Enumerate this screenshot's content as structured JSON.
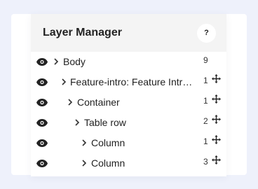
{
  "panel": {
    "title": "Layer Manager",
    "help_label": "?"
  },
  "layers": [
    {
      "name": "Body",
      "count": "9",
      "has_move": false,
      "level": 0
    },
    {
      "name": "Feature-intro: Feature Intro ...",
      "count": "1",
      "has_move": true,
      "level": 1
    },
    {
      "name": "Container",
      "count": "1",
      "has_move": true,
      "level": 2
    },
    {
      "name": "Table row",
      "count": "2",
      "has_move": true,
      "level": 3
    },
    {
      "name": "Column",
      "count": "1",
      "has_move": true,
      "level": 4
    },
    {
      "name": "Column",
      "count": "3",
      "has_move": true,
      "level": 4
    }
  ],
  "icons": {
    "visibility": "eye-icon",
    "expand": "chevron-right-icon",
    "drag": "move-icon"
  },
  "colors": {
    "background": "#eef1fb",
    "header": "#f4f4f4",
    "text": "#222222"
  }
}
